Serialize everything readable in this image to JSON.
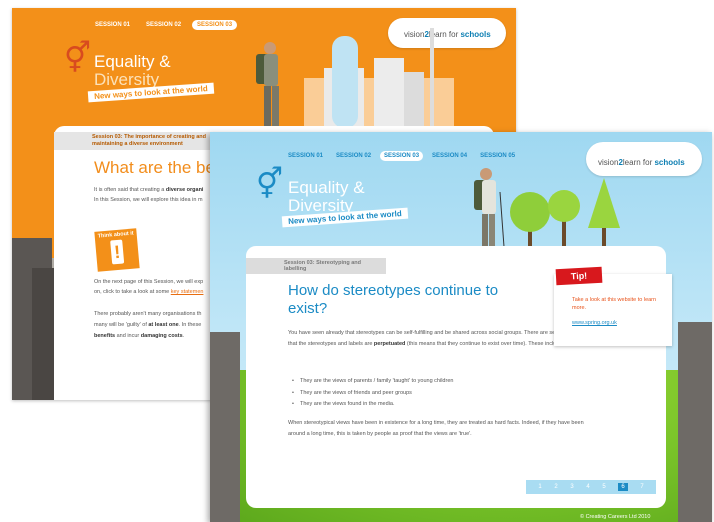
{
  "back": {
    "colors": {
      "accent": "#f39019"
    },
    "nav": [
      "SESSION 01",
      "SESSION 02",
      "SESSION 03"
    ],
    "nav_active_index": 2,
    "brand": {
      "pre": "vision",
      "num": "2",
      "mid": "learn for ",
      "bold": "schools"
    },
    "logo": {
      "line1": "Equality &",
      "line2": "Diversity",
      "tagline": "New ways to look at the world"
    },
    "session_label": "Session 03: The importance of creating and maintaining a diverse environment",
    "heading": "What are the ber",
    "p1_pre": "It is often said that creating a ",
    "p1_bold": "diverse organi",
    "p2": "In this Session, we will explore this idea in m",
    "think_label": "Think about it",
    "think_symbol": "!",
    "p3": "On the next page of this Session, we will exp",
    "p4_pre": "on, click to take a look at some ",
    "p4_link": "key statemen",
    "p5": "There probably aren't many organisations th",
    "p6_pre": "many will be 'guilty' of ",
    "p6_bold": "at least one",
    "p6_post": ". In these",
    "p7_b1": "benefits",
    "p7_mid": " and incur ",
    "p7_b2": "damaging costs",
    "p7_end": "."
  },
  "front": {
    "colors": {
      "accent": "#1b8bc5",
      "tip": "#d8181d"
    },
    "nav": [
      "SESSION 01",
      "SESSION 02",
      "SESSION 03",
      "SESSION 04",
      "SESSION 05"
    ],
    "nav_active_index": 2,
    "brand": {
      "pre": "vision",
      "num": "2",
      "mid": "learn for ",
      "bold": "schools"
    },
    "logo": {
      "line1": "Equality &",
      "line2": "Diversity",
      "tagline": "New ways to look at the world"
    },
    "session_label": "Session 03: Stereotyping and labelling",
    "heading": "How do stereotypes continue to exist?",
    "p1_a": "You have seen already that stereotypes can be self-fulfilling and be shared across social groups. There are several ways that the stereotypes and labels are ",
    "p1_bold": "perpetuated",
    "p1_b": " (this means that they continue to exist over time). These include:",
    "bullets": [
      "They are the views of parents / family 'taught' to young children",
      "They are the views of friends and peer groups",
      "They are the views found in the media."
    ],
    "p2": "When stereotypical views have been in existence for a long time, they are treated as hard facts. Indeed, if they have been around a long time, this is taken by people as proof that the views are 'true'.",
    "tip": {
      "badge": "Tip!",
      "text": "Take a look at this website to learn more.",
      "link": "www.spring.org.uk"
    },
    "pager": [
      "1",
      "2",
      "3",
      "4",
      "5",
      "6",
      "7"
    ],
    "pager_current_index": 5,
    "copyright": "© Creating Careers Ltd 2010"
  }
}
